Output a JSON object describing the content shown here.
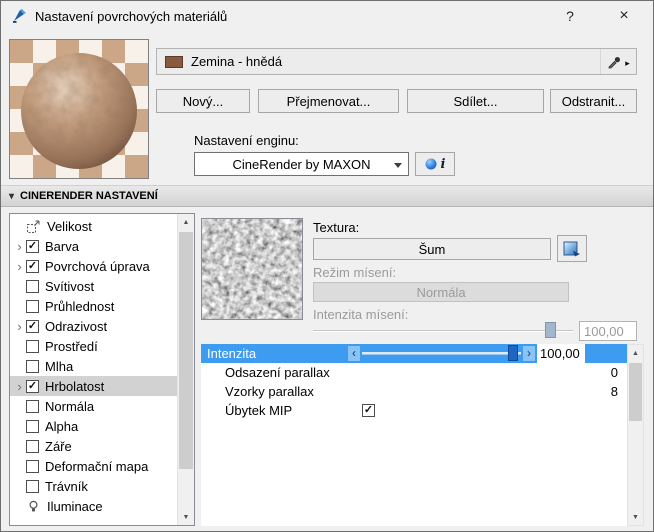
{
  "window": {
    "title": "Nastavení povrchových materiálů",
    "help": "?",
    "close": "×"
  },
  "material": {
    "name": "Zemina - hnědá",
    "swatch_color": "#8a5a3f"
  },
  "buttons": {
    "new": "Nový...",
    "rename": "Přejmenovat...",
    "share": "Sdílet...",
    "remove": "Odstranit..."
  },
  "engine": {
    "label": "Nastavení enginu:",
    "value": "CineRender by MAXON",
    "info": "i"
  },
  "section": {
    "title": "CINERENDER NASTAVENÍ"
  },
  "channels": [
    {
      "label": "Velikost",
      "icon": "resize-icon",
      "checked": null,
      "expandable": false,
      "selected": false
    },
    {
      "label": "Barva",
      "checked": true,
      "expandable": true,
      "selected": false
    },
    {
      "label": "Povrchová úprava",
      "checked": true,
      "expandable": true,
      "selected": false
    },
    {
      "label": "Svítivost",
      "checked": false,
      "expandable": false,
      "selected": false
    },
    {
      "label": "Průhlednost",
      "checked": false,
      "expandable": false,
      "selected": false
    },
    {
      "label": "Odrazivost",
      "checked": true,
      "expandable": true,
      "selected": false
    },
    {
      "label": "Prostředí",
      "checked": false,
      "expandable": false,
      "selected": false
    },
    {
      "label": "Mlha",
      "checked": false,
      "expandable": false,
      "selected": false
    },
    {
      "label": "Hrbolatost",
      "checked": true,
      "expandable": true,
      "selected": true
    },
    {
      "label": "Normála",
      "checked": false,
      "expandable": false,
      "selected": false
    },
    {
      "label": "Alpha",
      "checked": false,
      "expandable": false,
      "selected": false
    },
    {
      "label": "Záře",
      "checked": false,
      "expandable": false,
      "selected": false
    },
    {
      "label": "Deformační mapa",
      "checked": false,
      "expandable": false,
      "selected": false
    },
    {
      "label": "Trávník",
      "checked": false,
      "expandable": false,
      "selected": false
    },
    {
      "label": "Iluminace",
      "icon": "lamp-icon",
      "checked": null,
      "expandable": false,
      "selected": false
    }
  ],
  "texture": {
    "label": "Textura:",
    "type_button": "Šum"
  },
  "blend_mode": {
    "label": "Režim mísení:",
    "value": "Normála",
    "enabled": false
  },
  "blend_intensity": {
    "label": "Intenzita mísení:",
    "value": "100,00",
    "enabled": false
  },
  "properties": [
    {
      "label": "Intenzita",
      "value": "100,00",
      "control": "slider",
      "selected": true
    },
    {
      "label": "Odsazení parallax",
      "value": "0"
    },
    {
      "label": "Vzorky parallax",
      "value": "8"
    },
    {
      "label": "Úbytek MIP",
      "control": "checkbox",
      "checked": true
    }
  ],
  "colors": {
    "selection": "#3d9bf0",
    "selected_channel_bg": "#d2d2d2",
    "dialog_bg": "#f0f0f0"
  }
}
